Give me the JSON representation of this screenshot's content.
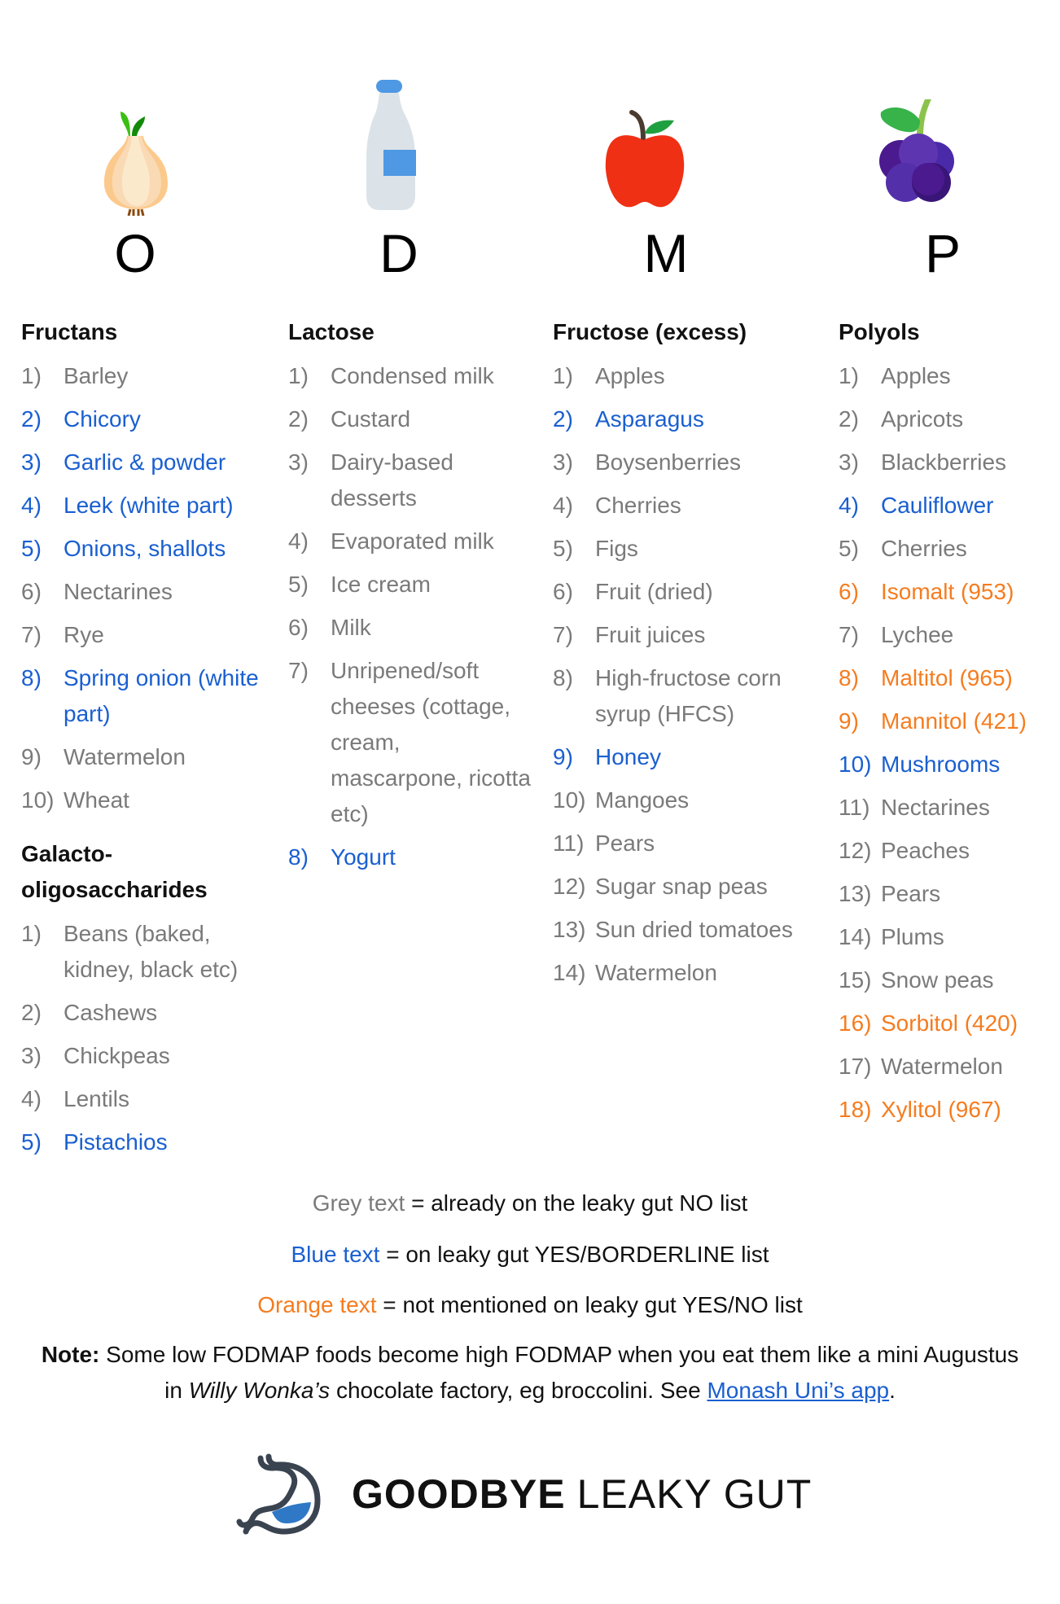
{
  "columns": [
    {
      "letter": "O",
      "icon": "onion-icon",
      "categories": [
        {
          "title": "Fructans",
          "items": [
            {
              "num": "1)",
              "text": "Barley",
              "color": "grey"
            },
            {
              "num": "2)",
              "text": "Chicory",
              "color": "blue"
            },
            {
              "num": "3)",
              "text": "Garlic & powder",
              "color": "blue"
            },
            {
              "num": "4)",
              "text": "Leek (white part)",
              "color": "blue"
            },
            {
              "num": "5)",
              "text": "Onions, shallots",
              "color": "blue"
            },
            {
              "num": "6)",
              "text": "Nectarines",
              "color": "grey"
            },
            {
              "num": "7)",
              "text": "Rye",
              "color": "grey"
            },
            {
              "num": "8)",
              "text": "Spring onion (white part)",
              "color": "blue"
            },
            {
              "num": "9)",
              "text": "Watermelon",
              "color": "grey"
            },
            {
              "num": "10)",
              "text": "Wheat",
              "color": "grey"
            }
          ]
        },
        {
          "title": "Galacto-oligosaccharides",
          "items": [
            {
              "num": "1)",
              "text": "Beans (baked, kidney, black etc)",
              "color": "grey"
            },
            {
              "num": "2)",
              "text": "Cashews",
              "color": "grey"
            },
            {
              "num": "3)",
              "text": "Chickpeas",
              "color": "grey"
            },
            {
              "num": "4)",
              "text": "Lentils",
              "color": "grey"
            },
            {
              "num": "5)",
              "text": "Pistachios",
              "color": "blue"
            }
          ]
        }
      ]
    },
    {
      "letter": "D",
      "icon": "milk-bottle-icon",
      "categories": [
        {
          "title": "Lactose",
          "items": [
            {
              "num": "1)",
              "text": "Condensed milk",
              "color": "grey"
            },
            {
              "num": "2)",
              "text": "Custard",
              "color": "grey"
            },
            {
              "num": "3)",
              "text": "Dairy-based desserts",
              "color": "grey"
            },
            {
              "num": "4)",
              "text": "Evaporated milk",
              "color": "grey"
            },
            {
              "num": "5)",
              "text": "Ice cream",
              "color": "grey"
            },
            {
              "num": "6)",
              "text": "Milk",
              "color": "grey"
            },
            {
              "num": "7)",
              "text": "Unripened/soft cheeses (cottage, cream, mascarpone, ricotta etc)",
              "color": "grey"
            },
            {
              "num": "8)",
              "text": "Yogurt",
              "color": "blue"
            }
          ]
        }
      ]
    },
    {
      "letter": "M",
      "icon": "apple-icon",
      "categories": [
        {
          "title": "Fructose (excess)",
          "items": [
            {
              "num": "1)",
              "text": "Apples",
              "color": "grey"
            },
            {
              "num": "2)",
              "text": "Asparagus",
              "color": "blue"
            },
            {
              "num": "3)",
              "text": "Boysenberries",
              "color": "grey"
            },
            {
              "num": "4)",
              "text": "Cherries",
              "color": "grey"
            },
            {
              "num": "5)",
              "text": "Figs",
              "color": "grey"
            },
            {
              "num": "6)",
              "text": "Fruit (dried)",
              "color": "grey"
            },
            {
              "num": "7)",
              "text": "Fruit juices",
              "color": "grey"
            },
            {
              "num": "8)",
              "text": "High-fructose corn syrup (HFCS)",
              "color": "grey"
            },
            {
              "num": "9)",
              "text": "Honey",
              "color": "blue"
            },
            {
              "num": "10)",
              "text": "Mangoes",
              "color": "grey"
            },
            {
              "num": "11)",
              "text": "Pears",
              "color": "grey"
            },
            {
              "num": "12)",
              "text": "Sugar snap peas",
              "color": "grey"
            },
            {
              "num": "13)",
              "text": "Sun dried tomatoes",
              "color": "grey"
            },
            {
              "num": "14)",
              "text": "Watermelon",
              "color": "grey"
            }
          ]
        }
      ]
    },
    {
      "letter": "P",
      "icon": "blackberry-icon",
      "categories": [
        {
          "title": "Polyols",
          "items": [
            {
              "num": "1)",
              "text": "Apples",
              "color": "grey"
            },
            {
              "num": "2)",
              "text": "Apricots",
              "color": "grey"
            },
            {
              "num": "3)",
              "text": "Blackberries",
              "color": "grey"
            },
            {
              "num": "4)",
              "text": "Cauliflower",
              "color": "blue"
            },
            {
              "num": "5)",
              "text": "Cherries",
              "color": "grey"
            },
            {
              "num": "6)",
              "text": "Isomalt (953)",
              "color": "orange"
            },
            {
              "num": "7)",
              "text": "Lychee",
              "color": "grey"
            },
            {
              "num": "8)",
              "text": "Maltitol (965)",
              "color": "orange"
            },
            {
              "num": "9)",
              "text": "Mannitol (421)",
              "color": "orange"
            },
            {
              "num": "10)",
              "text": "Mushrooms",
              "color": "blue"
            },
            {
              "num": "11)",
              "text": "Nectarines",
              "color": "grey"
            },
            {
              "num": "12)",
              "text": "Peaches",
              "color": "grey"
            },
            {
              "num": "13)",
              "text": "Pears",
              "color": "grey"
            },
            {
              "num": "14)",
              "text": "Plums",
              "color": "grey"
            },
            {
              "num": "15)",
              "text": "Snow peas",
              "color": "grey"
            },
            {
              "num": "16)",
              "text": "Sorbitol (420)",
              "color": "orange"
            },
            {
              "num": "17)",
              "text": "Watermelon",
              "color": "grey"
            },
            {
              "num": "18)",
              "text": "Xylitol (967)",
              "color": "orange"
            }
          ]
        }
      ]
    }
  ],
  "legend": [
    {
      "key": "Grey text",
      "color": "grey",
      "desc": " = already on the leaky gut NO list"
    },
    {
      "key": "Blue text",
      "color": "blue",
      "desc": " = on leaky gut YES/BORDERLINE list"
    },
    {
      "key": "Orange text",
      "color": "orange",
      "desc": " = not mentioned on leaky gut YES/NO list"
    }
  ],
  "note": {
    "label": "Note:",
    "text1": " Some low FODMAP foods become high FODMAP when you eat them like a mini Augustus in ",
    "italic": "Willy Wonka’s",
    "text2": " chocolate factory, eg broccolini. See ",
    "link": "Monash Uni’s app",
    "end": "."
  },
  "logo": {
    "bold": "GOODBYE",
    "light": "LEAKY GUT"
  },
  "colors": {
    "grey": "#7a7a7a",
    "blue": "#1a5fd0",
    "orange": "#f57c1f"
  }
}
